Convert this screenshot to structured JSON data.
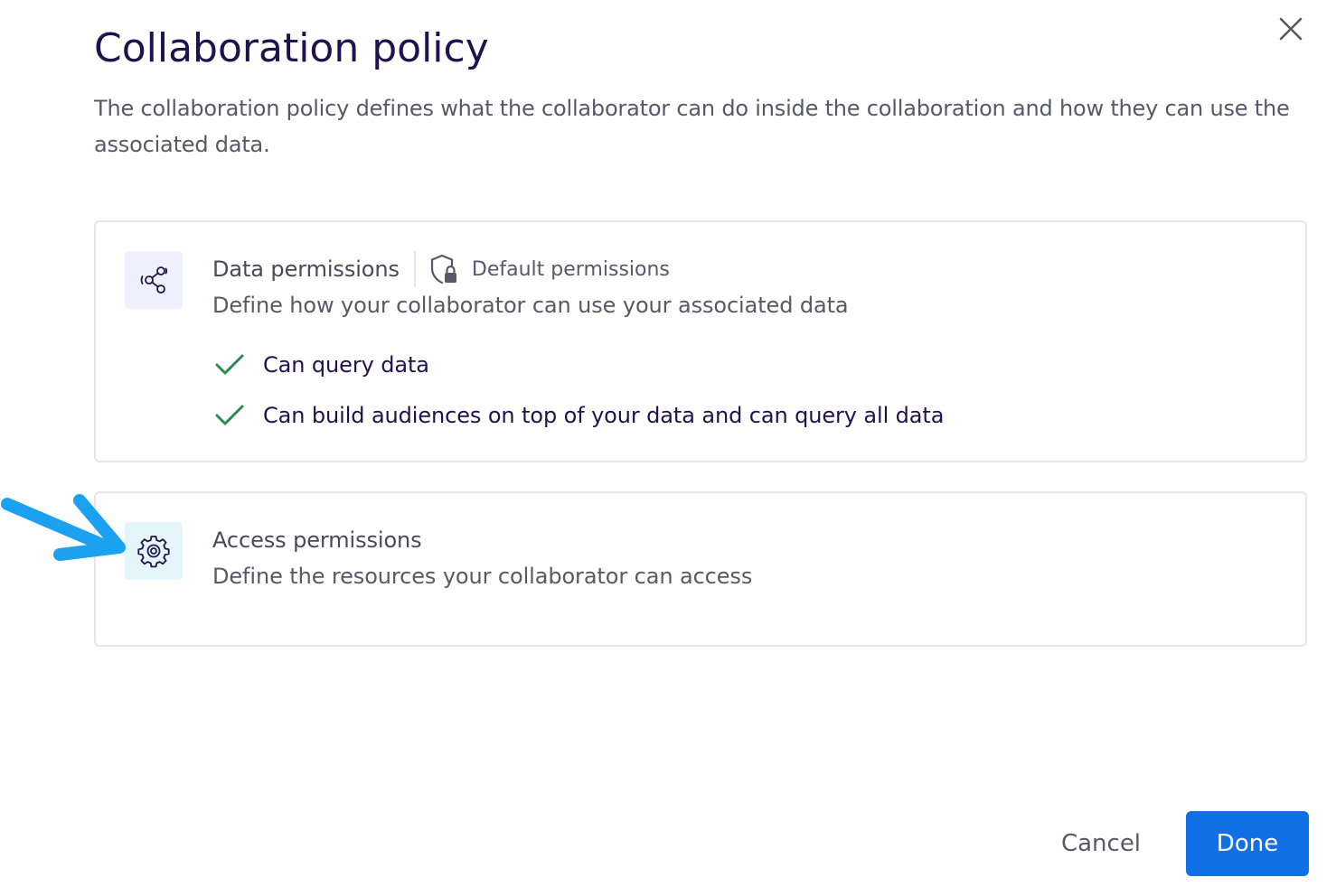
{
  "dialog": {
    "title": "Collaboration policy",
    "subtitle": "The collaboration policy defines what the collaborator can do inside the collaboration and how they can use the associated data.",
    "close_icon": "close-icon"
  },
  "data_permissions": {
    "icon": "share-nodes-icon",
    "title": "Data permissions",
    "badge_icon": "shield-lock-icon",
    "badge_label": "Default permissions",
    "description": "Define how your collaborator can use your associated data",
    "permissions": [
      {
        "label": "Can query data",
        "icon": "check-icon"
      },
      {
        "label": "Can build audiences on top of your data and can query all data",
        "icon": "check-icon"
      }
    ]
  },
  "access_permissions": {
    "icon": "gear-icon",
    "title": "Access permissions",
    "description": "Define the resources your collaborator can access"
  },
  "actions": {
    "cancel_label": "Cancel",
    "done_label": "Done"
  },
  "colors": {
    "title": "#20124d",
    "body_text": "#595866",
    "primary_button": "#1170e6",
    "check": "#2e8b57",
    "annotation_arrow": "#1aa1f0"
  }
}
